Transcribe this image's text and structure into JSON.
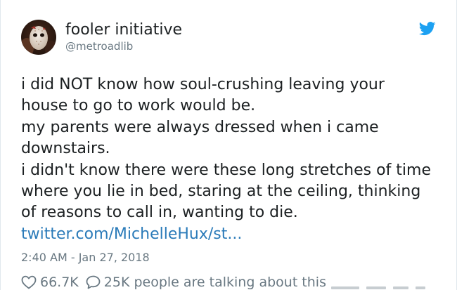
{
  "user": {
    "display_name": "fooler initiative",
    "handle": "@metroadlib",
    "avatar_icon": "masked-face-avatar"
  },
  "brand": {
    "icon": "twitter-bird-icon",
    "color": "#1da1f2"
  },
  "tweet": {
    "lines": [
      "i did NOT know how soul-crushing leaving your",
      "house to go to work would be.",
      "my parents were always dressed when i came",
      "downstairs.",
      "i didn't know there were these long stretches of time",
      "where you lie in bed, staring at the ceiling, thinking",
      "of reasons to call in, wanting to die."
    ],
    "link": "twitter.com/MichelleHux/st...",
    "link_color": "#2b7bb9",
    "timestamp": "2:40 AM - Jan 27, 2018"
  },
  "actions": {
    "likes": "66.7K",
    "like_icon": "heart-icon",
    "reply_icon": "speech-bubble-icon",
    "talking": "25K people are talking about this"
  },
  "colors": {
    "text": "#1c2022",
    "secondary": "#697882"
  }
}
